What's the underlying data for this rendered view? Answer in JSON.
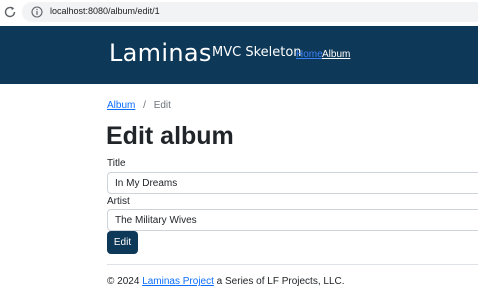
{
  "browser": {
    "url": "localhost:8080/album/edit/1"
  },
  "navbar": {
    "brand": "Laminas",
    "subtitle": "MVC Skeleton",
    "links": [
      {
        "label": "Home"
      },
      {
        "label": "Album"
      }
    ]
  },
  "breadcrumb": {
    "parent": "Album",
    "separator": "/",
    "current": "Edit"
  },
  "page": {
    "title": "Edit album"
  },
  "form": {
    "title_label": "Title",
    "title_value": "In My Dreams",
    "artist_label": "Artist",
    "artist_value": "The Military Wives",
    "submit_label": "Edit"
  },
  "footer": {
    "prefix": "© 2024",
    "link": "Laminas Project",
    "suffix": "a Series of LF Projects, LLC."
  },
  "colors": {
    "navbar_bg": "#0e3858",
    "link": "#0d6efd",
    "button_bg": "#0e3858"
  }
}
